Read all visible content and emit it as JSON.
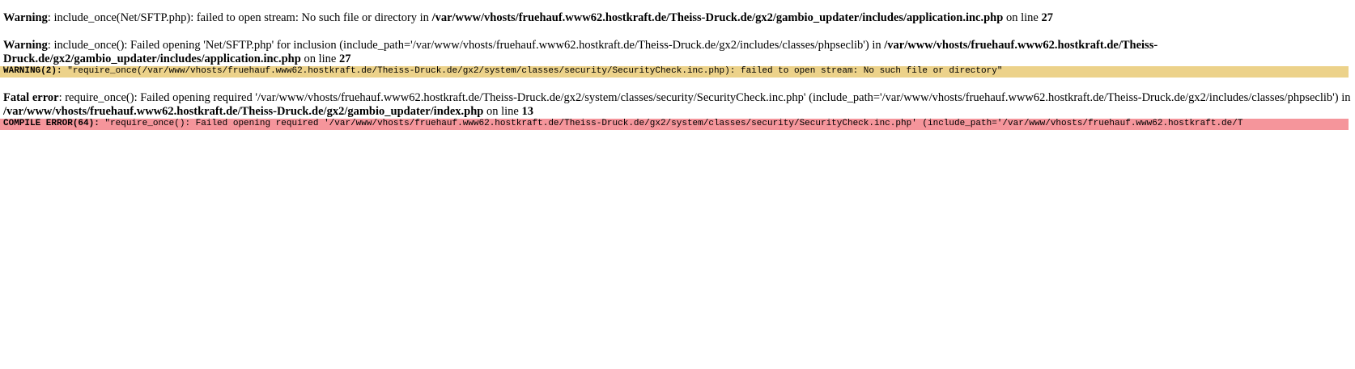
{
  "messages": [
    {
      "label": "Warning",
      "text": ": include_once(Net/SFTP.php): failed to open stream: No such file or directory in ",
      "file": "/var/www/vhosts/fruehauf.www62.hostkraft.de/Theiss-Druck.de/gx2/gambio_updater/includes/application.inc.php",
      "on_line": " on line ",
      "line": "27"
    },
    {
      "label": "Warning",
      "text": ": include_once(): Failed opening 'Net/SFTP.php' for inclusion (include_path='/var/www/vhosts/fruehauf.www62.hostkraft.de/Theiss-Druck.de/gx2/includes/classes/phpseclib') in ",
      "file": "/var/www/vhosts/fruehauf.www62.hostkraft.de/Theiss-Druck.de/gx2/gambio_updater/includes/application.inc.php",
      "on_line": " on line ",
      "line": "27"
    },
    {
      "label": "Fatal error",
      "text": ": require_once(): Failed opening required '/var/www/vhosts/fruehauf.www62.hostkraft.de/Theiss-Druck.de/gx2/system/classes/security/SecurityCheck.inc.php' (include_path='/var/www/vhosts/fruehauf.www62.hostkraft.de/Theiss-Druck.de/gx2/includes/classes/phpseclib') in ",
      "file": "/var/www/vhosts/fruehauf.www62.hostkraft.de/Theiss-Druck.de/gx2/gambio_updater/index.php",
      "on_line": " on line ",
      "line": "13"
    }
  ],
  "bars": {
    "warning": {
      "label": "WARNING(2):",
      "text": " \"require_once(/var/www/vhosts/fruehauf.www62.hostkraft.de/Theiss-Druck.de/gx2/system/classes/security/SecurityCheck.inc.php): failed to open stream: No such file or directory\""
    },
    "error": {
      "label": "COMPILE ERROR(64):",
      "text": " \"require_once(): Failed opening required '/var/www/vhosts/fruehauf.www62.hostkraft.de/Theiss-Druck.de/gx2/system/classes/security/SecurityCheck.inc.php' (include_path='/var/www/vhosts/fruehauf.www62.hostkraft.de/T"
    }
  },
  "colors": {
    "warning_bar": "#ecd28a",
    "error_bar": "#f5959b"
  }
}
